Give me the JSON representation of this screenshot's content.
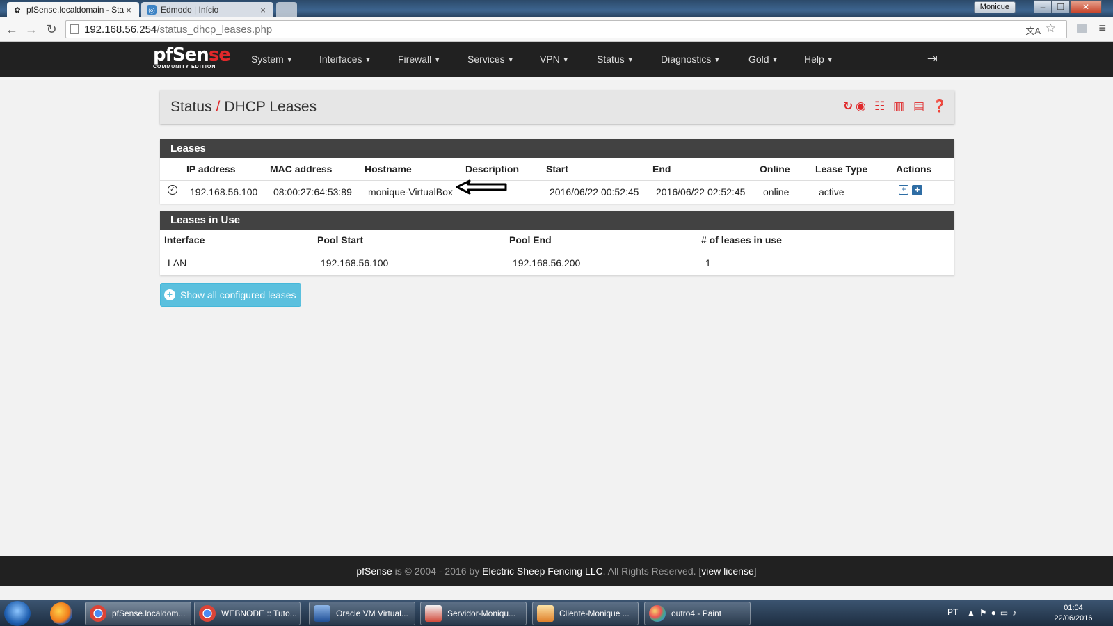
{
  "browser": {
    "tabs": [
      {
        "title": "pfSense.localdomain - Sta",
        "close": "×",
        "active": true
      },
      {
        "title": "Edmodo | Início",
        "close": "×",
        "active": false
      }
    ],
    "window_user": "Monique",
    "url_host": "192.168.56.254",
    "url_path": "/status_dhcp_leases.php"
  },
  "navbar": {
    "logo_main_a": "pfS",
    "logo_main_b": "en",
    "logo_main_c": "se",
    "logo_sub": "COMMUNITY EDITION",
    "menu": [
      "System",
      "Interfaces",
      "Firewall",
      "Services",
      "VPN",
      "Status",
      "Diagnostics",
      "Gold",
      "Help"
    ]
  },
  "header": {
    "crumb_parent": "Status",
    "separator": "/",
    "crumb_current": "DHCP Leases"
  },
  "leases": {
    "title": "Leases",
    "columns": [
      "IP address",
      "MAC address",
      "Hostname",
      "Description",
      "Start",
      "End",
      "Online",
      "Lease Type",
      "Actions"
    ],
    "rows": [
      {
        "ip": "192.168.56.100",
        "mac": "08:00:27:64:53:89",
        "hostname": "monique-VirtualBox",
        "description": "",
        "start": "2016/06/22 00:52:45",
        "end": "2016/06/22 02:52:45",
        "online": "online",
        "lease_type": "active"
      }
    ]
  },
  "leases_in_use": {
    "title": "Leases in Use",
    "columns": [
      "Interface",
      "Pool Start",
      "Pool End",
      "# of leases in use"
    ],
    "rows": [
      {
        "interface": "LAN",
        "pool_start": "192.168.56.100",
        "pool_end": "192.168.56.200",
        "count": "1"
      }
    ]
  },
  "show_all_button": "Show all configured leases",
  "footer": {
    "brand": "pfSense",
    "text_a": " is © 2004 - 2016 by ",
    "company": "Electric Sheep Fencing LLC",
    "text_b": ". All Rights Reserved. [",
    "license_link": "view license",
    "text_c": "]"
  },
  "taskbar": {
    "tasks": [
      "pfSense.localdom...",
      "WEBNODE :: Tuto...",
      "Oracle VM Virtual...",
      "Servidor-Moniqu...",
      "Cliente-Monique ...",
      "outro4 - Paint"
    ],
    "language": "PT",
    "time": "01:04",
    "date": "22/06/2016"
  },
  "colors": {
    "brand_red": "#e0282a",
    "navbar_bg": "#212121",
    "panel_heading_bg": "#424242",
    "info_button": "#5bc0de",
    "action_blue": "#2e6da4"
  }
}
